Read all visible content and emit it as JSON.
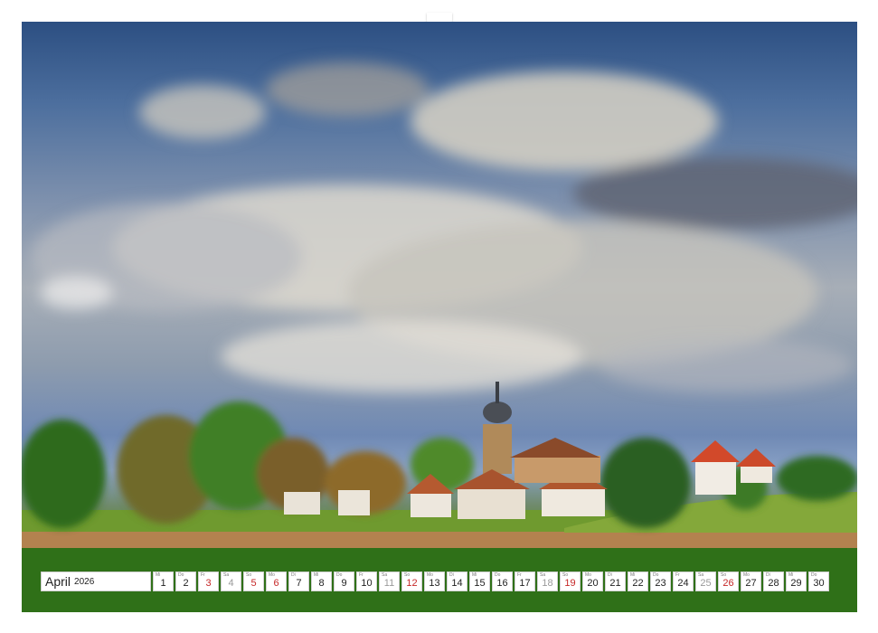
{
  "calendar": {
    "month": "April",
    "year": "2026",
    "days": [
      {
        "wd": "Mi",
        "d": "1",
        "t": "weekday"
      },
      {
        "wd": "Do",
        "d": "2",
        "t": "weekday"
      },
      {
        "wd": "Fr",
        "d": "3",
        "t": "holiday"
      },
      {
        "wd": "Sa",
        "d": "4",
        "t": "sat"
      },
      {
        "wd": "So",
        "d": "5",
        "t": "sun"
      },
      {
        "wd": "Mo",
        "d": "6",
        "t": "holiday"
      },
      {
        "wd": "Di",
        "d": "7",
        "t": "weekday"
      },
      {
        "wd": "Mi",
        "d": "8",
        "t": "weekday"
      },
      {
        "wd": "Do",
        "d": "9",
        "t": "weekday"
      },
      {
        "wd": "Fr",
        "d": "10",
        "t": "weekday"
      },
      {
        "wd": "Sa",
        "d": "11",
        "t": "sat"
      },
      {
        "wd": "So",
        "d": "12",
        "t": "sun"
      },
      {
        "wd": "Mo",
        "d": "13",
        "t": "weekday"
      },
      {
        "wd": "Di",
        "d": "14",
        "t": "weekday"
      },
      {
        "wd": "Mi",
        "d": "15",
        "t": "weekday"
      },
      {
        "wd": "Do",
        "d": "16",
        "t": "weekday"
      },
      {
        "wd": "Fr",
        "d": "17",
        "t": "weekday"
      },
      {
        "wd": "Sa",
        "d": "18",
        "t": "sat"
      },
      {
        "wd": "So",
        "d": "19",
        "t": "sun"
      },
      {
        "wd": "Mo",
        "d": "20",
        "t": "weekday"
      },
      {
        "wd": "Di",
        "d": "21",
        "t": "weekday"
      },
      {
        "wd": "Mi",
        "d": "22",
        "t": "weekday"
      },
      {
        "wd": "Do",
        "d": "23",
        "t": "weekday"
      },
      {
        "wd": "Fr",
        "d": "24",
        "t": "weekday"
      },
      {
        "wd": "Sa",
        "d": "25",
        "t": "sat"
      },
      {
        "wd": "So",
        "d": "26",
        "t": "sun"
      },
      {
        "wd": "Mo",
        "d": "27",
        "t": "weekday"
      },
      {
        "wd": "Di",
        "d": "28",
        "t": "weekday"
      },
      {
        "wd": "Mi",
        "d": "29",
        "t": "weekday"
      },
      {
        "wd": "Do",
        "d": "30",
        "t": "weekday"
      }
    ]
  }
}
